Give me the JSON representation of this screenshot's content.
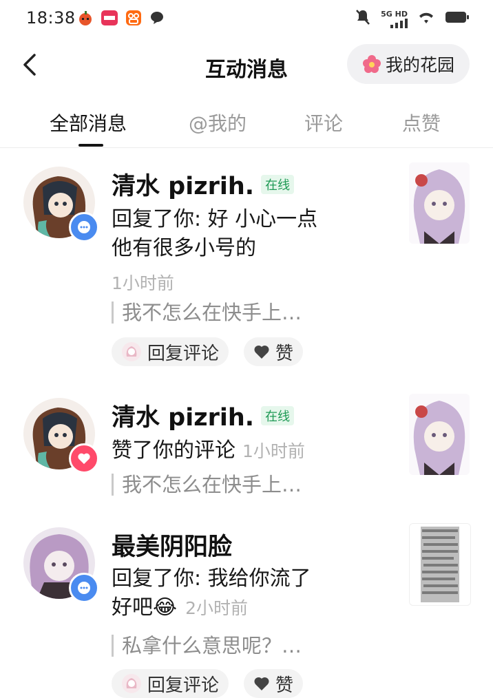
{
  "status_bar": {
    "time": "18:38",
    "network": "5G HD"
  },
  "header": {
    "title": "互动消息",
    "garden_label": "我的花园"
  },
  "tabs": [
    {
      "label": "全部消息",
      "active": true
    },
    {
      "label": "@我的",
      "active": false
    },
    {
      "label": "评论",
      "active": false
    },
    {
      "label": "点赞",
      "active": false
    }
  ],
  "messages": [
    {
      "name": "清水 pizrih.",
      "online": "在线",
      "badge": "comment-icon",
      "text_line1": "回复了你: 好 小心一点",
      "text_line2": "他有很多小号的",
      "time": "1小时前",
      "quote": "我不怎么在快手上…",
      "reply_label": "回复评论",
      "like_label": "赞"
    },
    {
      "name": "清水 pizrih.",
      "online": "在线",
      "badge": "heart-icon",
      "text_line1": "赞了你的评论",
      "time": "1小时前",
      "quote": "我不怎么在快手上…"
    },
    {
      "name": "最美阴阳脸",
      "badge": "comment-icon",
      "text_line1": "回复了你: 我给你流了",
      "text_line2": "好吧😂",
      "time": "2小时前",
      "quote": "私拿什么意思呢？…",
      "reply_label": "回复评论",
      "like_label": "赞"
    }
  ],
  "colors": {
    "online_green": "#1f9a55",
    "comment_badge_blue": "#4a8bf0",
    "like_badge_red": "#ff4a6a"
  }
}
